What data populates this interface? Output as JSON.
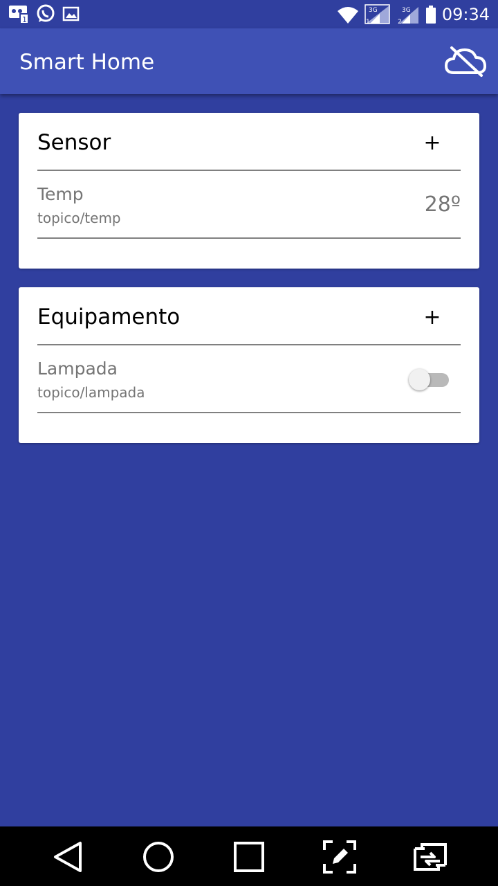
{
  "status_bar": {
    "time": "09:34",
    "left_icons": [
      "message-icon",
      "whatsapp-icon",
      "image-icon"
    ],
    "right_icons": [
      "wifi-icon",
      "signal-3g-sim1-icon",
      "signal-3g-sim2-icon",
      "battery-icon"
    ],
    "sim1_label": "3G",
    "sim2_label": "3G"
  },
  "app_bar": {
    "title": "Smart Home",
    "action_icon": "cloud-off-icon"
  },
  "cards": {
    "sensor": {
      "title": "Sensor",
      "add_label": "+",
      "items": [
        {
          "name": "Temp",
          "topic": "topico/temp",
          "value": "28º"
        }
      ]
    },
    "equipment": {
      "title": "Equipamento",
      "add_label": "+",
      "items": [
        {
          "name": "Lampada",
          "topic": "topico/lampada",
          "state": "off"
        }
      ]
    }
  },
  "nav_bar": {
    "buttons": [
      "back-icon",
      "home-icon",
      "recents-icon",
      "edit-screenshot-icon",
      "switch-icon"
    ]
  },
  "colors": {
    "primary": "#3F51B5",
    "primary_dark": "#303F9F",
    "card": "#FFFFFF",
    "secondary_text": "#757575"
  }
}
